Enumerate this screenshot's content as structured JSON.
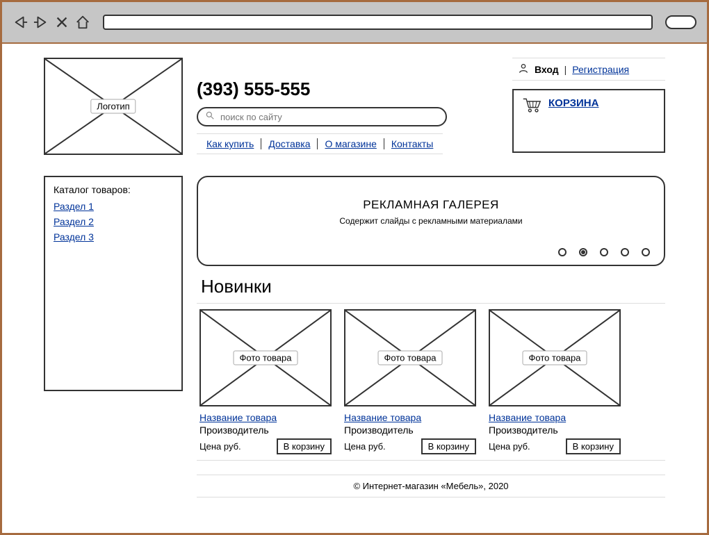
{
  "logo_label": "Логотип",
  "phone": "(393) 555-555",
  "search_placeholder": "поиск по сайту",
  "top_nav": [
    "Как купить",
    "Доставка",
    "О магазине",
    "Контакты"
  ],
  "auth": {
    "login": "Вход",
    "register": "Регистрация"
  },
  "cart_label": "КОРЗИНА",
  "catalog": {
    "title": "Каталог товаров:",
    "items": [
      "Раздел 1",
      "Раздел 2",
      "Раздел 3"
    ]
  },
  "banner": {
    "title": "РЕКЛАМНАЯ ГАЛЕРЕЯ",
    "subtitle": "Содержит слайды с рекламными материалами",
    "active_dot": 1,
    "dot_count": 5
  },
  "new_section_title": "Новинки",
  "products": [
    {
      "photo_label": "Фото товара",
      "name": "Название товара",
      "maker": "Производитель",
      "price": "Цена руб.",
      "btn": "В корзину"
    },
    {
      "photo_label": "Фото товара",
      "name": "Название товара",
      "maker": "Производитель",
      "price": "Цена руб.",
      "btn": "В корзину"
    },
    {
      "photo_label": "Фото товара",
      "name": "Название товара",
      "maker": "Производитель",
      "price": "Цена руб.",
      "btn": "В корзину"
    }
  ],
  "footer": "© Интернет-магазин «Мебель», 2020"
}
